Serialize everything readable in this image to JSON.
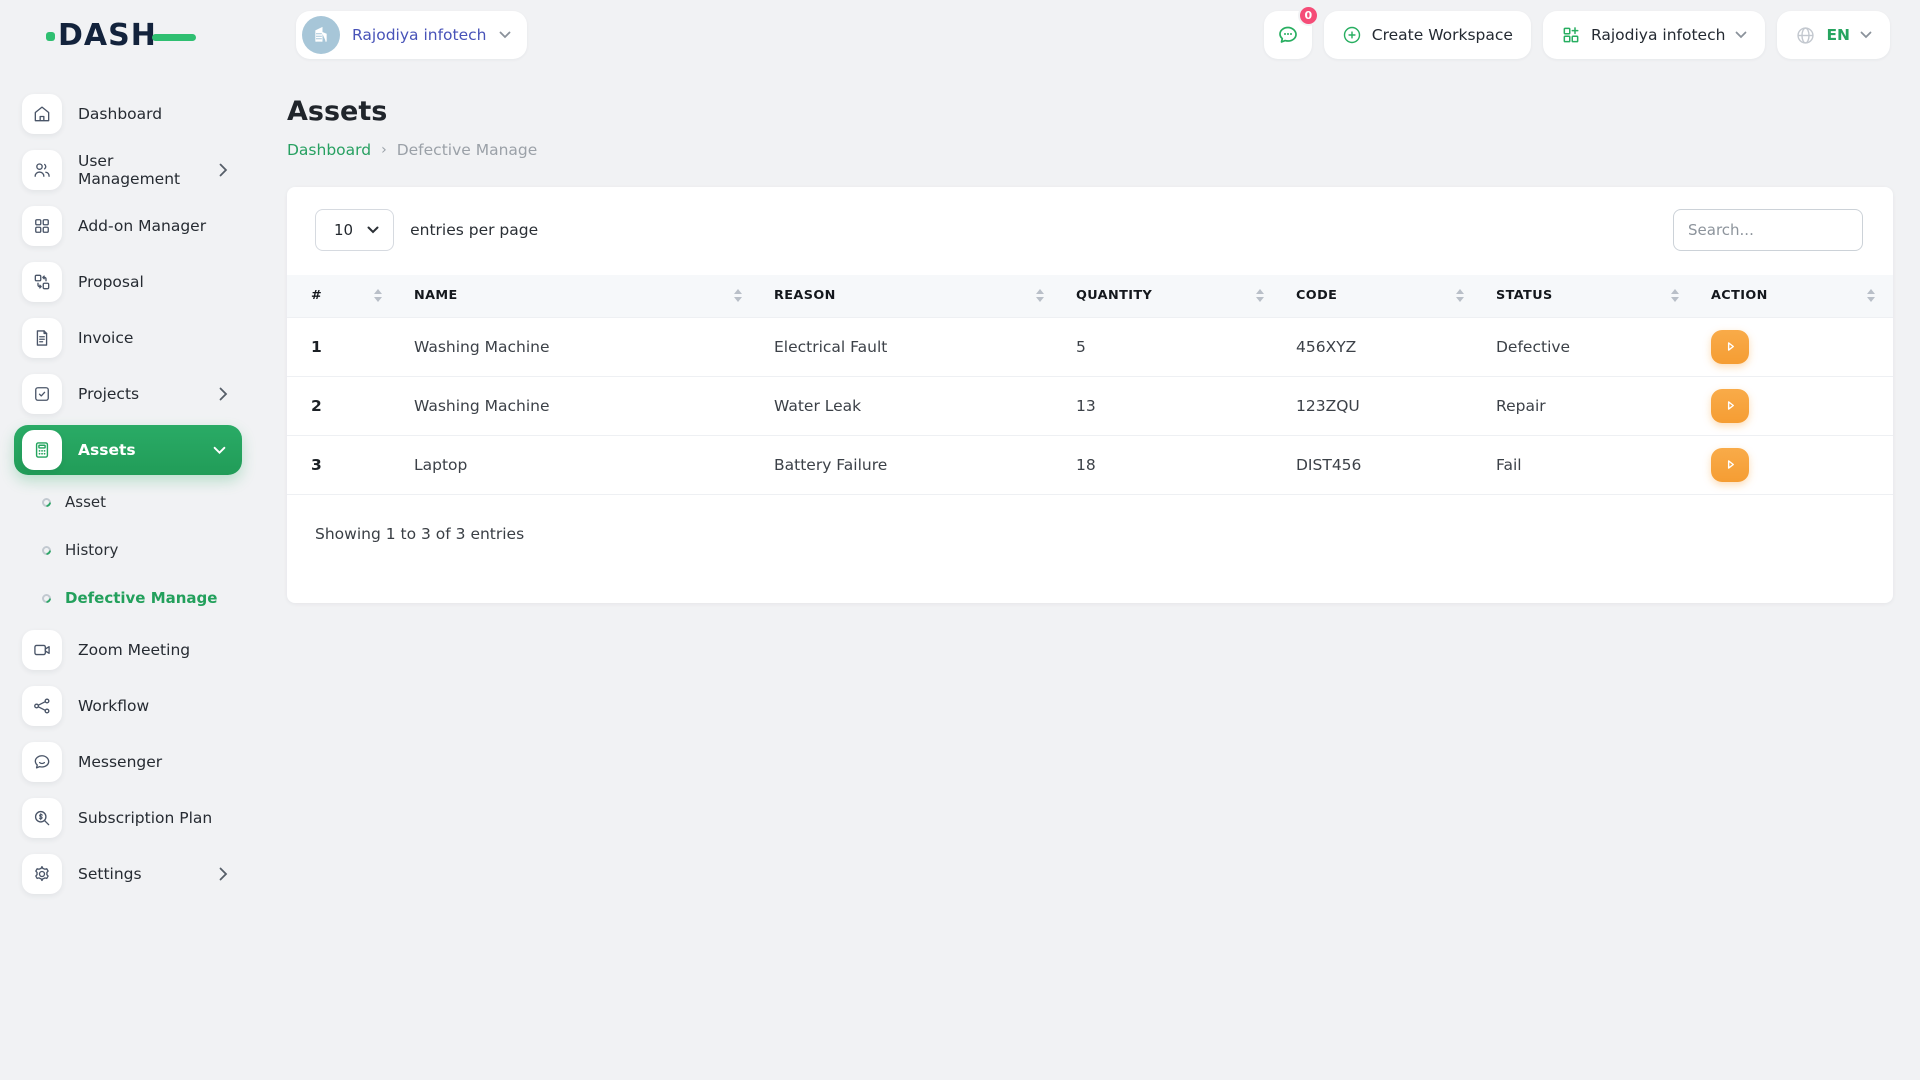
{
  "brand": {
    "name": "DASH"
  },
  "colors": {
    "primary_green": "#26a45f",
    "accent_green_bright": "#2fbf71",
    "action_orange": "#f7a23c",
    "badge_pink": "#f54c77",
    "workspace_indigo": "#4853b8"
  },
  "topbar": {
    "workspace_switcher": "Rajodiya infotech",
    "notifications_badge": "0",
    "create_workspace": "Create Workspace",
    "workspace_menu": "Rajodiya infotech",
    "language": "EN"
  },
  "sidebar": {
    "items": [
      {
        "label": "Dashboard",
        "icon": "home-icon"
      },
      {
        "label": "User Management",
        "icon": "users-icon",
        "has_submenu": true
      },
      {
        "label": "Add-on Manager",
        "icon": "grid-icon"
      },
      {
        "label": "Proposal",
        "icon": "proposal-icon"
      },
      {
        "label": "Invoice",
        "icon": "invoice-icon"
      },
      {
        "label": "Projects",
        "icon": "check-square-icon",
        "has_submenu": true
      },
      {
        "label": "Assets",
        "icon": "calculator-icon",
        "active": true,
        "expanded": true
      },
      {
        "label": "Zoom Meeting",
        "icon": "video-icon"
      },
      {
        "label": "Workflow",
        "icon": "share-icon"
      },
      {
        "label": "Messenger",
        "icon": "chat-icon"
      },
      {
        "label": "Subscription Plan",
        "icon": "search-dollar-icon"
      },
      {
        "label": "Settings",
        "icon": "gear-icon",
        "has_submenu": true
      }
    ],
    "assets_submenu": [
      {
        "label": "Asset"
      },
      {
        "label": "History"
      },
      {
        "label": "Defective Manage",
        "active": true
      }
    ]
  },
  "page": {
    "title": "Assets",
    "breadcrumb": {
      "root": "Dashboard",
      "separator": "›",
      "current": "Defective Manage"
    }
  },
  "table_card": {
    "entries_value": "10",
    "entries_label": "entries per page",
    "search_placeholder": "Search...",
    "columns": [
      "#",
      "NAME",
      "REASON",
      "QUANTITY",
      "CODE",
      "STATUS",
      "ACTION"
    ],
    "rows": [
      {
        "num": "1",
        "name": "Washing Machine",
        "reason": "Electrical Fault",
        "quantity": "5",
        "code": "456XYZ",
        "status": "Defective"
      },
      {
        "num": "2",
        "name": "Washing Machine",
        "reason": "Water Leak",
        "quantity": "13",
        "code": "123ZQU",
        "status": "Repair"
      },
      {
        "num": "3",
        "name": "Laptop",
        "reason": "Battery Failure",
        "quantity": "18",
        "code": "DIST456",
        "status": "Fail"
      }
    ],
    "footer": "Showing 1 to 3 of 3 entries"
  }
}
